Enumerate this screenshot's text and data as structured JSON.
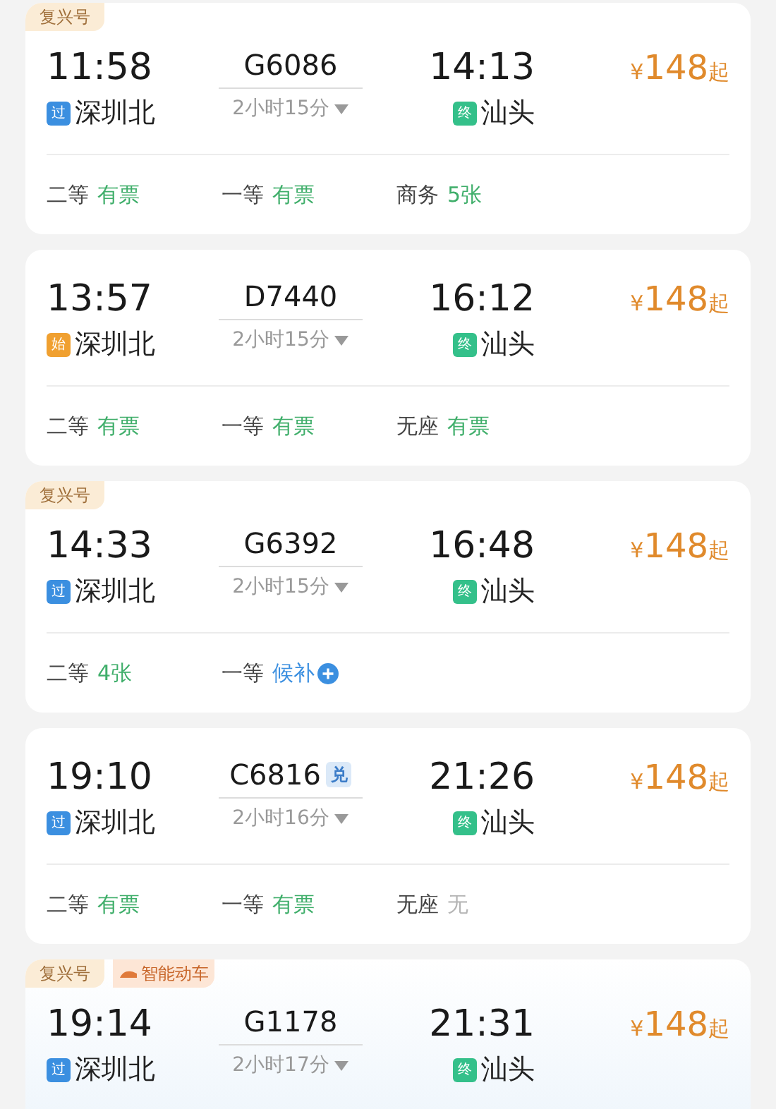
{
  "trains": [
    {
      "tags": [
        {
          "label": "复兴号",
          "kind": "fuxing"
        }
      ],
      "depart_time": "11:58",
      "train_no": "G6086",
      "arrive_time": "14:13",
      "from": {
        "badge": "过",
        "color": "#3b8fe0",
        "name": "深圳北"
      },
      "duration": "2小时15分",
      "to": {
        "badge": "终",
        "color": "#34c08a",
        "name": "汕头"
      },
      "price": {
        "currency": "¥",
        "amount": "148",
        "suffix": "起"
      },
      "seats": [
        {
          "class": "二等",
          "status": "有票",
          "kind": "available"
        },
        {
          "class": "一等",
          "status": "有票",
          "kind": "available"
        },
        {
          "class": "商务",
          "status": "5张",
          "kind": "available"
        }
      ]
    },
    {
      "depart_time": "13:57",
      "train_no": "D7440",
      "arrive_time": "16:12",
      "from": {
        "badge": "始",
        "color": "#f0a030",
        "name": "深圳北"
      },
      "duration": "2小时15分",
      "to": {
        "badge": "终",
        "color": "#34c08a",
        "name": "汕头"
      },
      "price": {
        "currency": "¥",
        "amount": "148",
        "suffix": "起"
      },
      "seats": [
        {
          "class": "二等",
          "status": "有票",
          "kind": "available"
        },
        {
          "class": "一等",
          "status": "有票",
          "kind": "available"
        },
        {
          "class": "无座",
          "status": "有票",
          "kind": "available"
        }
      ]
    },
    {
      "tags": [
        {
          "label": "复兴号",
          "kind": "fuxing"
        }
      ],
      "depart_time": "14:33",
      "train_no": "G6392",
      "arrive_time": "16:48",
      "from": {
        "badge": "过",
        "color": "#3b8fe0",
        "name": "深圳北"
      },
      "duration": "2小时15分",
      "to": {
        "badge": "终",
        "color": "#34c08a",
        "name": "汕头"
      },
      "price": {
        "currency": "¥",
        "amount": "148",
        "suffix": "起"
      },
      "seats": [
        {
          "class": "二等",
          "status": "4张",
          "kind": "available"
        },
        {
          "class": "一等",
          "status": "候补",
          "kind": "waitlist"
        }
      ]
    },
    {
      "depart_time": "19:10",
      "train_no": "C6816",
      "train_badge": "兑",
      "arrive_time": "21:26",
      "from": {
        "badge": "过",
        "color": "#3b8fe0",
        "name": "深圳北"
      },
      "duration": "2小时16分",
      "to": {
        "badge": "终",
        "color": "#34c08a",
        "name": "汕头"
      },
      "price": {
        "currency": "¥",
        "amount": "148",
        "suffix": "起"
      },
      "seats": [
        {
          "class": "二等",
          "status": "有票",
          "kind": "available"
        },
        {
          "class": "一等",
          "status": "有票",
          "kind": "available"
        },
        {
          "class": "无座",
          "status": "无",
          "kind": "none"
        }
      ]
    },
    {
      "tags": [
        {
          "label": "复兴号",
          "kind": "fuxing"
        },
        {
          "label": "智能动车",
          "kind": "smart"
        }
      ],
      "depart_time": "19:14",
      "train_no": "G1178",
      "arrive_time": "21:31",
      "from": {
        "badge": "过",
        "color": "#3b8fe0",
        "name": "深圳北"
      },
      "duration": "2小时17分",
      "to": {
        "badge": "终",
        "color": "#34c08a",
        "name": "汕头"
      },
      "price": {
        "currency": "¥",
        "amount": "148",
        "suffix": "起"
      }
    }
  ]
}
